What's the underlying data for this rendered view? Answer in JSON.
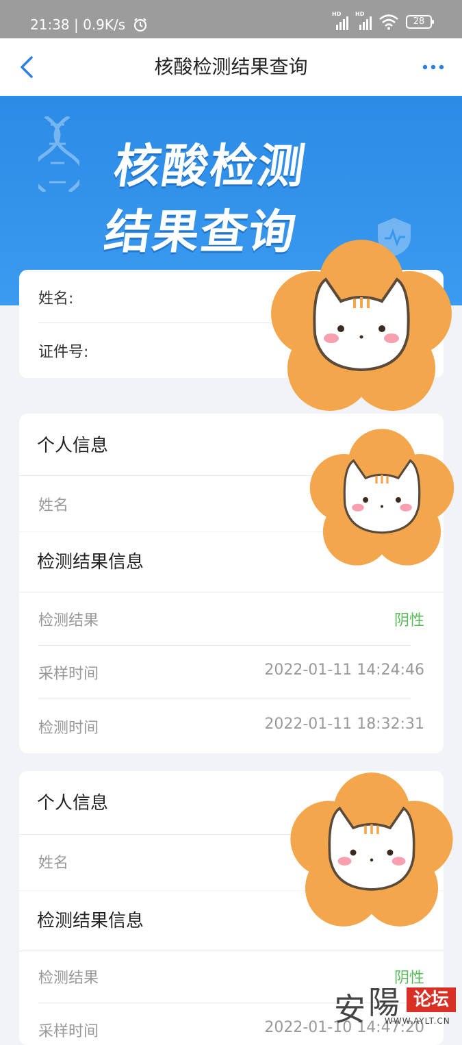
{
  "status_bar": {
    "time_speed": "21:38 | 0.9K/s",
    "battery": "28",
    "hd1": "HD",
    "hd2": "HD"
  },
  "nav": {
    "title": "核酸检测结果查询"
  },
  "banner": {
    "line1": "核酸检测",
    "line2": "结果查询"
  },
  "query": {
    "name_label": "姓名:",
    "id_label": "证件号:"
  },
  "records": [
    {
      "personal_title": "个人信息",
      "name_label": "姓名",
      "result_title": "检测结果信息",
      "result_label": "检测结果",
      "result_value": "阴性",
      "sample_label": "采样时间",
      "sample_value": "2022-01-11 14:24:46",
      "test_label": "检测时间",
      "test_value": "2022-01-11 18:32:31"
    },
    {
      "personal_title": "个人信息",
      "name_label": "姓名",
      "result_title": "检测结果信息",
      "result_label": "检测结果",
      "result_value": "阴性",
      "sample_label": "采样时间",
      "sample_value": "2022-01-10 14:47:20"
    }
  ],
  "watermark": {
    "char1": "安",
    "char2": "陽",
    "badge": "论坛",
    "url": "WWW.AYLT.CN"
  },
  "colors": {
    "banner_blue": "#2b8be6",
    "nav_accent": "#2b7fe0",
    "negative_green": "#5cb85c",
    "sticker_orange": "#f3a64c"
  },
  "icons": [
    "back-arrow-icon",
    "more-icon",
    "alarm-icon",
    "signal-icon",
    "wifi-icon",
    "battery-icon",
    "dna-icon",
    "shield-icon",
    "cat-sticker"
  ]
}
